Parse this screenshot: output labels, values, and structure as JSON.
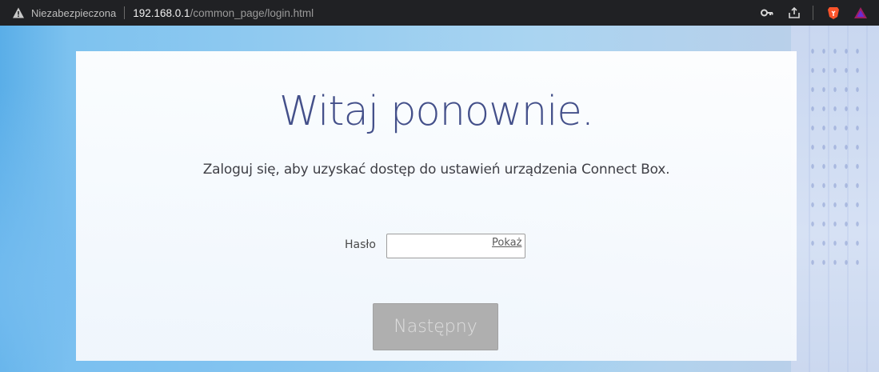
{
  "browser": {
    "security_label": "Niezabezpieczona",
    "url_host": "192.168.0.1",
    "url_path": "/common_page/login.html",
    "icons": [
      "warning-icon",
      "key-icon",
      "share-icon",
      "brave-shield-icon",
      "brave-rewards-icon"
    ]
  },
  "login": {
    "title": "Witaj ponownie.",
    "subtitle": "Zaloguj się, aby uzyskać dostęp do ustawień urządzenia Connect Box.",
    "password_label": "Hasło",
    "password_value": "",
    "show_label": "Pokaż",
    "next_button": "Następny"
  },
  "colors": {
    "title": "#44508a",
    "button_disabled": "#afafaf"
  }
}
